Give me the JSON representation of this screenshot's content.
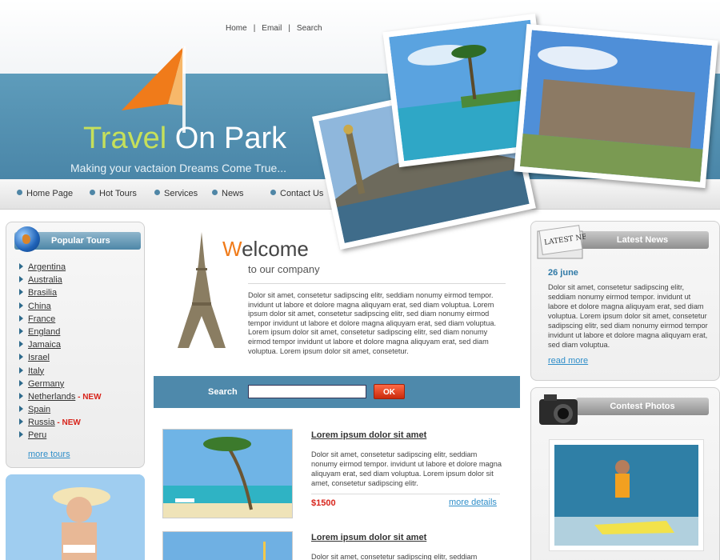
{
  "top_nav": [
    "Home",
    "Email",
    "Search"
  ],
  "brand": {
    "title_part1": "Travel",
    "title_part2": " On Park",
    "tagline": "Making your vactaion Dreams Come True..."
  },
  "menu": [
    "Home Page",
    "Hot Tours",
    "Services",
    "News",
    "Contact Us"
  ],
  "popular_tours": {
    "title": "Popular Tours",
    "items": [
      {
        "name": "Argentina",
        "badge": ""
      },
      {
        "name": "Australia",
        "badge": ""
      },
      {
        "name": "Brasilia",
        "badge": ""
      },
      {
        "name": "China",
        "badge": ""
      },
      {
        "name": "France",
        "badge": ""
      },
      {
        "name": "England",
        "badge": ""
      },
      {
        "name": "Jamaica",
        "badge": ""
      },
      {
        "name": "Israel",
        "badge": ""
      },
      {
        "name": "Italy",
        "badge": ""
      },
      {
        "name": "Germany",
        "badge": ""
      },
      {
        "name": "Netherlands",
        "badge": " - NEW"
      },
      {
        "name": "Spain",
        "badge": ""
      },
      {
        "name": "Russia",
        "badge": " - NEW"
      },
      {
        "name": "Peru",
        "badge": ""
      }
    ],
    "more_label": "more tours"
  },
  "welcome": {
    "title_first": "W",
    "title_rest": "elcome",
    "subtitle": "to our company",
    "text": "Dolor sit amet, consetetur sadipscing elitr, seddiam nonumy eirmod tempor. invidunt ut labore et dolore magna aliquyam erat, sed diam voluptua. Lorem ipsum dolor sit amet, consetetur sadipscing elitr, sed diam nonumy eirmod tempor invidunt ut labore et dolore magna aliquyam erat, sed diam voluptua. Lorem ipsum dolor sit amet, consetetur sadipscing elitr, sed diam nonumy eirmod tempor invidunt ut labore et dolore magna aliquyam erat, sed diam voluptua. Lorem ipsum dolor sit amet, consetetur."
  },
  "search": {
    "label": "Search",
    "value": "",
    "button": "OK"
  },
  "tours": [
    {
      "title": "Lorem ipsum dolor sit amet",
      "desc": "Dolor sit amet, consetetur sadipscing elitr, seddiam nonumy eirmod tempor. invidunt ut labore et dolore magna aliquyam erat, sed diam voluptua. Lorem ipsum dolor sit amet, consetetur sadipscing elitr.",
      "price": "$1500",
      "more": "more details"
    },
    {
      "title": "Lorem ipsum dolor sit amet",
      "desc": "Dolor sit amet, consetetur sadipscing elitr, seddiam",
      "price": "",
      "more": ""
    }
  ],
  "latest_news": {
    "title": "Latest News",
    "date": "26 june",
    "text": "Dolor sit amet, consetetur sadipscing elitr, seddiam nonumy eirmod tempor. invidunt ut labore et dolore magna aliquyam erat, sed diam voluptua. Lorem ipsum dolor sit amet, consetetur sadipscing elitr, sed diam nonumy eirmod tempor invidunt ut labore et dolore magna aliquyam erat, sed diam voluptua.",
    "more": "read more",
    "icon_text": "LATEST NEWS"
  },
  "contest": {
    "title": "Contest Photos"
  },
  "colors": {
    "accent_blue": "#4e89ab",
    "accent_orange": "#f07b1a",
    "badge_red": "#d8241b",
    "link_blue": "#2f8ec9"
  }
}
